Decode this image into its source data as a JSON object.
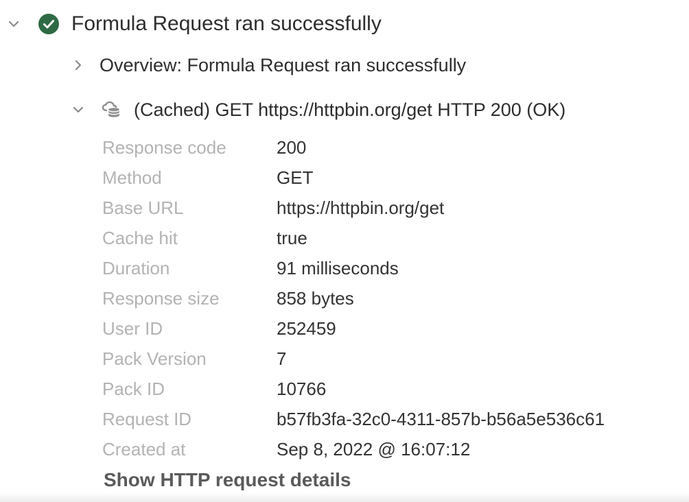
{
  "header": {
    "title": "Formula Request ran successfully",
    "status_color": "#2e6b45",
    "chevron_icon": "chevron-down-icon",
    "status_icon": "check-circle-icon"
  },
  "overview": {
    "label": "Overview: Formula Request ran successfully",
    "chevron_icon": "chevron-right-icon"
  },
  "request": {
    "label": "(Cached) GET https://httpbin.org/get HTTP 200 (OK)",
    "chevron_icon": "chevron-down-icon",
    "icon": "cloud-database-icon",
    "details": [
      {
        "key": "Response code",
        "value": "200"
      },
      {
        "key": "Method",
        "value": "GET"
      },
      {
        "key": "Base URL",
        "value": "https://httpbin.org/get"
      },
      {
        "key": "Cache hit",
        "value": "true"
      },
      {
        "key": "Duration",
        "value": "91 milliseconds"
      },
      {
        "key": "Response size",
        "value": "858 bytes"
      },
      {
        "key": "User ID",
        "value": "252459"
      },
      {
        "key": "Pack Version",
        "value": "7"
      },
      {
        "key": "Pack ID",
        "value": "10766"
      },
      {
        "key": "Request ID",
        "value": "b57fb3fa-32c0-4311-857b-b56a5e536c61"
      },
      {
        "key": "Created at",
        "value": "Sep 8, 2022 @ 16:07:12"
      }
    ],
    "show_details_label": "Show HTTP request details"
  }
}
